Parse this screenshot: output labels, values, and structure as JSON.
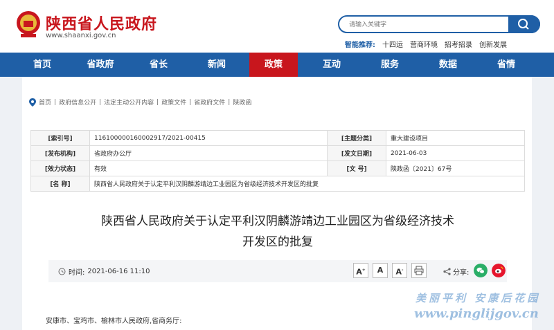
{
  "header": {
    "site_title": "陕西省人民政府",
    "site_url": "www.shaanxi.gov.cn",
    "search_placeholder": "请输入关键字",
    "hot_label": "智能推荐:",
    "hot_items": [
      "十四运",
      "营商环境",
      "招考招录",
      "创新发展"
    ]
  },
  "nav": {
    "items": [
      "首页",
      "省政府",
      "省长",
      "新闻",
      "政策",
      "互动",
      "服务",
      "数据",
      "省情"
    ],
    "active": "政策"
  },
  "breadcrumb": [
    "首页",
    "政府信息公开",
    "法定主动公开内容",
    "政策文件",
    "省政府文件",
    "陕政函"
  ],
  "meta": {
    "index_label": "[索引号]",
    "index_value": "116100000160002917/2021-00415",
    "topic_label": "[主题分类]",
    "topic_value": "重大建设项目",
    "org_label": "[发布机构]",
    "org_value": "省政府办公厅",
    "date_label": "[发文日期]",
    "date_value": "2021-06-03",
    "status_label": "[效力状态]",
    "status_value": "有效",
    "docno_label": "[文 号]",
    "docno_value": "陕政函〔2021〕67号",
    "name_label": "[名 称]",
    "name_value": "陕西省人民政府关于认定平利汉阴麟游靖边工业园区为省级经济技术开发区的批复"
  },
  "doc": {
    "title_line1": "陕西省人民政府关于认定平利汉阴麟游靖边工业园区为省级经济技术",
    "title_line2": "开发区的批复"
  },
  "toolbar": {
    "time_label": "时间:",
    "time_value": "2021-06-16 11:10",
    "font_large": "A",
    "font_mid": "A",
    "font_small": "A",
    "share_label": "分享:"
  },
  "body": {
    "recipients": "安康市、宝鸡市、榆林市人民政府,省商务厅:"
  },
  "watermark": {
    "line1": "美丽平利 安康后花园",
    "line2": "www.pinglijgov.cn"
  },
  "colors": {
    "brand_red": "#c8161d",
    "nav_blue": "#1f5fa6",
    "wechat_green": "#2aae67",
    "weibo_red": "#e6162d"
  }
}
